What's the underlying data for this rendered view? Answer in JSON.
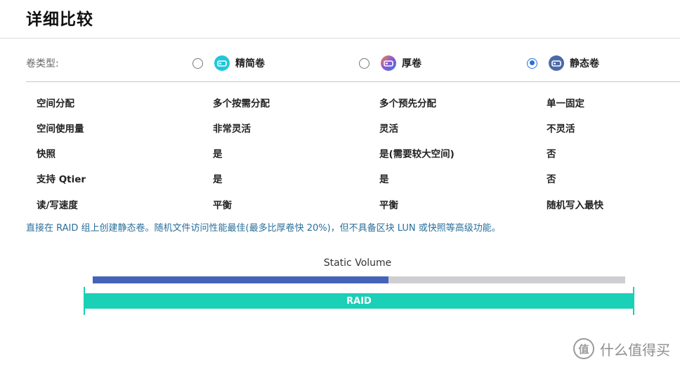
{
  "page": {
    "title": "详细比较"
  },
  "volume_type": {
    "label": "卷类型:",
    "options": [
      {
        "label": "精简卷",
        "selected": false,
        "icon": "thin-volume-icon",
        "icon_color": "#21c7d8"
      },
      {
        "label": "厚卷",
        "selected": false,
        "icon": "thick-volume-icon",
        "icon_color": "#8a57d8"
      },
      {
        "label": "静态卷",
        "selected": true,
        "icon": "static-volume-icon",
        "icon_color": "#4b6aa8"
      }
    ]
  },
  "comparison": {
    "rows": [
      [
        "空间分配",
        "多个按需分配",
        "多个预先分配",
        "单一固定"
      ],
      [
        "空间使用量",
        "非常灵活",
        "灵活",
        "不灵活"
      ],
      [
        "快照",
        "是",
        "是(需要较大空间)",
        "否"
      ],
      [
        "支持 Qtier",
        "是",
        "是",
        "否"
      ],
      [
        "读/写速度",
        "平衡",
        "平衡",
        "随机写入最快"
      ]
    ]
  },
  "description": "直接在 RAID 组上创建静态卷。随机文件访问性能最佳(最多比厚卷快 20%)，但不具备区块 LUN 或快照等高级功能。",
  "diagram": {
    "volume_label": "Static Volume",
    "raid_label": "RAID",
    "volume_fill_fraction": 0.555,
    "colors": {
      "volume_fill": "#4563b8",
      "track": "#cfcfd3",
      "raid": "#1ad0b6"
    }
  },
  "watermark": {
    "icon_text": "值",
    "text": "什么值得买"
  }
}
